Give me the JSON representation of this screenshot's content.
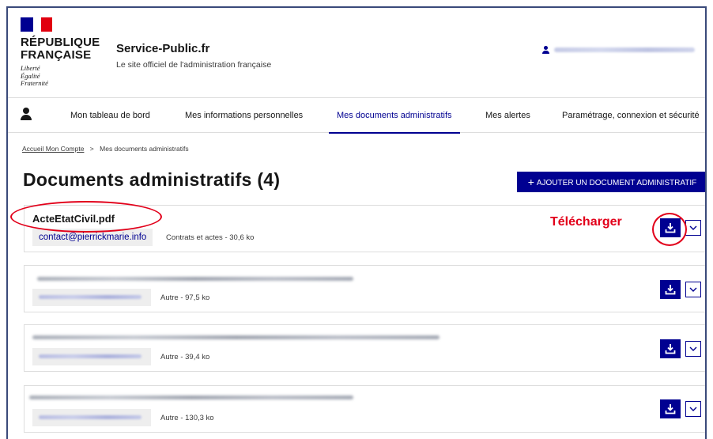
{
  "header": {
    "republic_title_line1": "RÉPUBLIQUE",
    "republic_title_line2": "FRANÇAISE",
    "devise": [
      "Liberté",
      "Égalité",
      "Fraternité"
    ],
    "service_name": "Service-Public.fr",
    "service_tagline": "Le site officiel de l'administration française"
  },
  "nav": {
    "items": [
      {
        "label": "Mon tableau de bord"
      },
      {
        "label": "Mes informations personnelles"
      },
      {
        "label": "Mes documents administratifs",
        "active": true
      },
      {
        "label": "Mes alertes"
      },
      {
        "label": "Paramétrage, connexion et sécurité"
      }
    ]
  },
  "breadcrumb": {
    "root": "Accueil Mon Compte",
    "separator": ">",
    "current": "Mes documents administratifs"
  },
  "page": {
    "title": "Documents administratifs (4)",
    "add_button_label": "AJOUTER UN DOCUMENT ADMINISTRATIF"
  },
  "documents": [
    {
      "name": "ActeEtatCivil.pdf",
      "owner": "contact@pierrickmarie.info",
      "meta": "Contrats et actes - 30,6 ko"
    },
    {
      "name": "",
      "owner": "",
      "meta": "Autre - 97,5 ko"
    },
    {
      "name": "",
      "owner": "",
      "meta": "Autre - 39,4 ko"
    },
    {
      "name": "",
      "owner": "",
      "meta": "Autre - 130,3 ko"
    }
  ],
  "annotation": {
    "label": "Télécharger",
    "color": "#e2001a"
  },
  "colors": {
    "primary": "#000091",
    "flag_red": "#e1000f"
  }
}
